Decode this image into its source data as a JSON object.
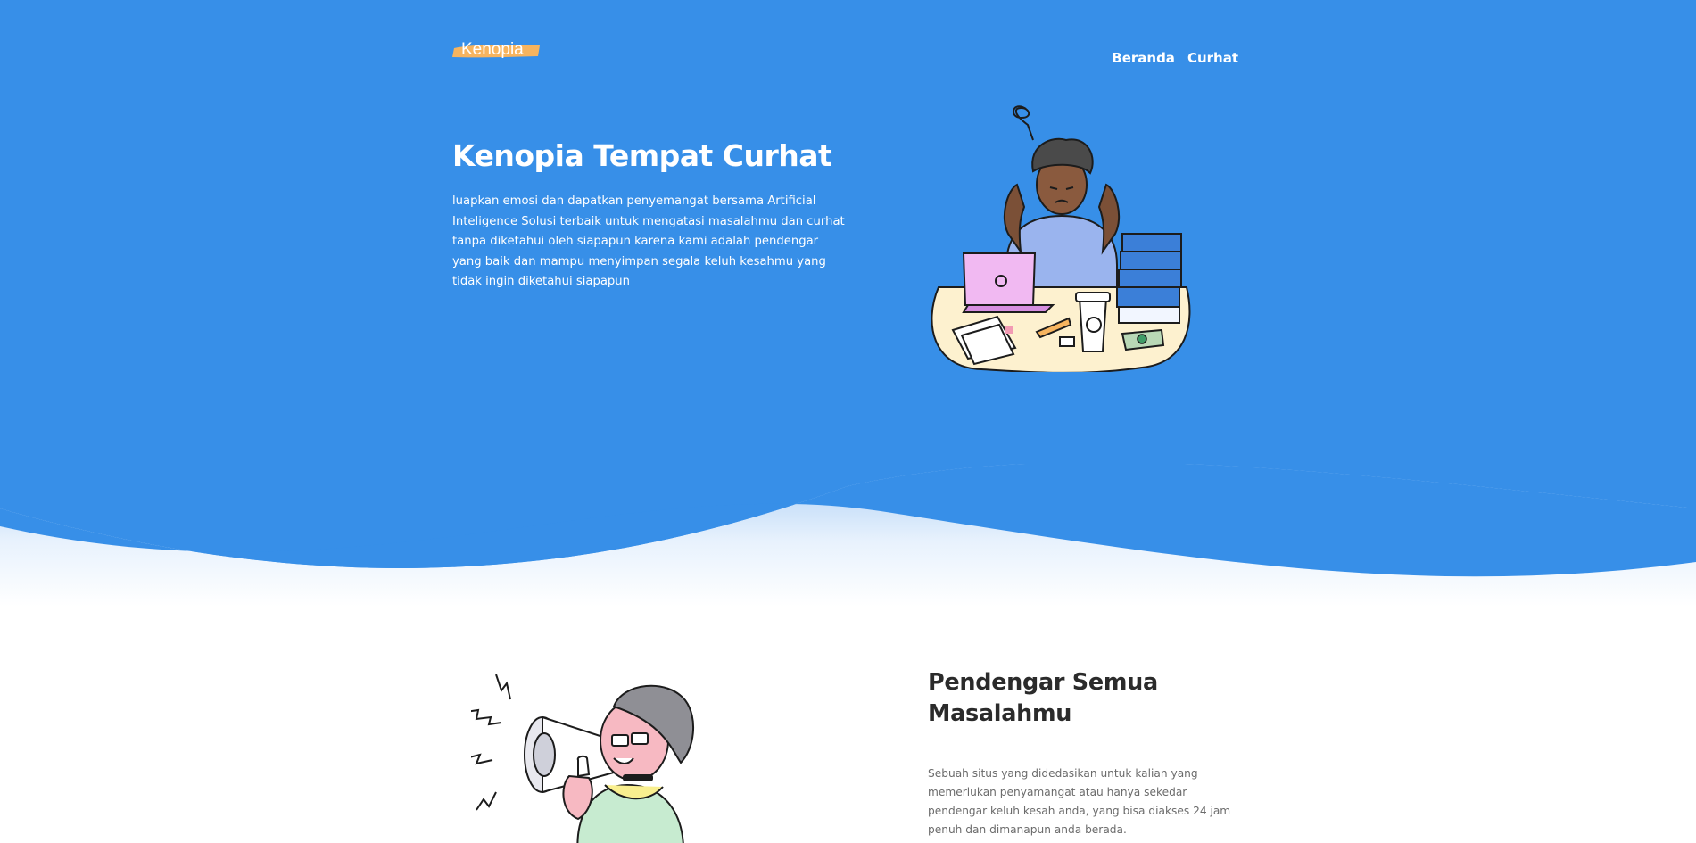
{
  "brand": {
    "name": "Kenopia",
    "highlight_color": "#f6b45f"
  },
  "nav": {
    "items": [
      {
        "label": "Beranda"
      },
      {
        "label": "Curhat"
      }
    ]
  },
  "hero": {
    "title": "Kenopia Tempat Curhat",
    "description": "luapkan emosi dan dapatkan penyemangat bersama Artificial Inteligence Solusi terbaik untuk mengatasi masalahmu dan curhat tanpa diketahui oleh siapapun karena kami adalah pendengar yang baik dan mampu menyimpan segala keluh kesahmu yang tidak ingin diketahui siapapun",
    "background_color": "#378fe8",
    "illustration_icon": "stressed-person-at-desk-illustration"
  },
  "feature": {
    "title": "Pendengar Semua Masalahmu",
    "description": "Sebuah situs yang didedasikan untuk kalian yang memerlukan penyamangat atau hanya sekedar pendengar keluh kesah anda, yang bisa diakses 24 jam penuh dan dimanapun anda berada.",
    "illustration_icon": "person-with-megaphone-illustration"
  }
}
